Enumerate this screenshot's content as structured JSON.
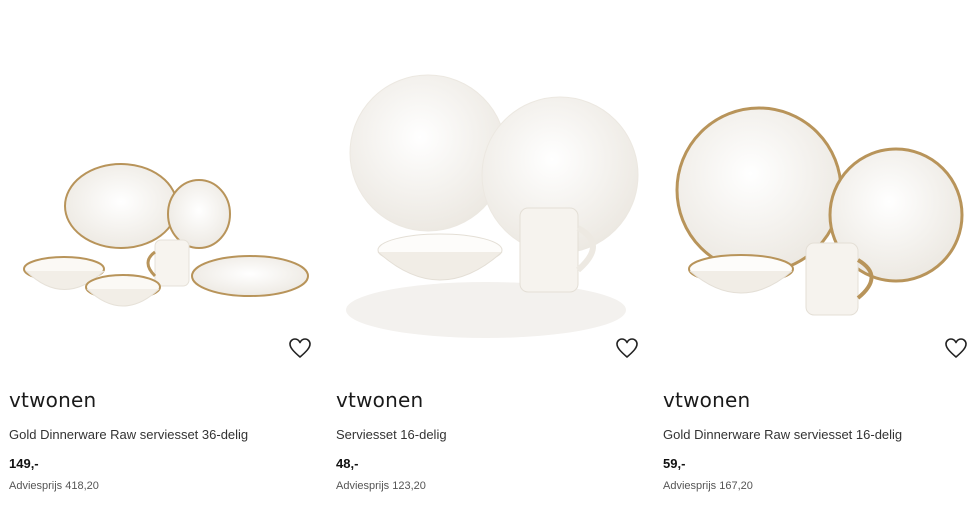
{
  "products": [
    {
      "brand": "vtwonen",
      "title": "Gold Dinnerware Raw serviesset 36-delig",
      "price": "149,-",
      "advice_price": "Adviesprijs 418,20",
      "image_icon": "dinnerware-gold-rim-36-image",
      "wishlist_icon": "heart-outline-icon"
    },
    {
      "brand": "vtwonen",
      "title": "Serviesset 16-delig",
      "price": "48,-",
      "advice_price": "Adviesprijs 123,20",
      "image_icon": "dinnerware-white-16-image",
      "wishlist_icon": "heart-outline-icon"
    },
    {
      "brand": "vtwonen",
      "title": "Gold Dinnerware Raw serviesset 16-delig",
      "price": "59,-",
      "advice_price": "Adviesprijs 167,20",
      "image_icon": "dinnerware-gold-rim-16-image",
      "wishlist_icon": "heart-outline-icon"
    }
  ],
  "colors": {
    "plate_white": "#f7f4ef",
    "gold_rim": "#b8945a",
    "text_dark": "#111111",
    "text_muted": "#555555"
  }
}
